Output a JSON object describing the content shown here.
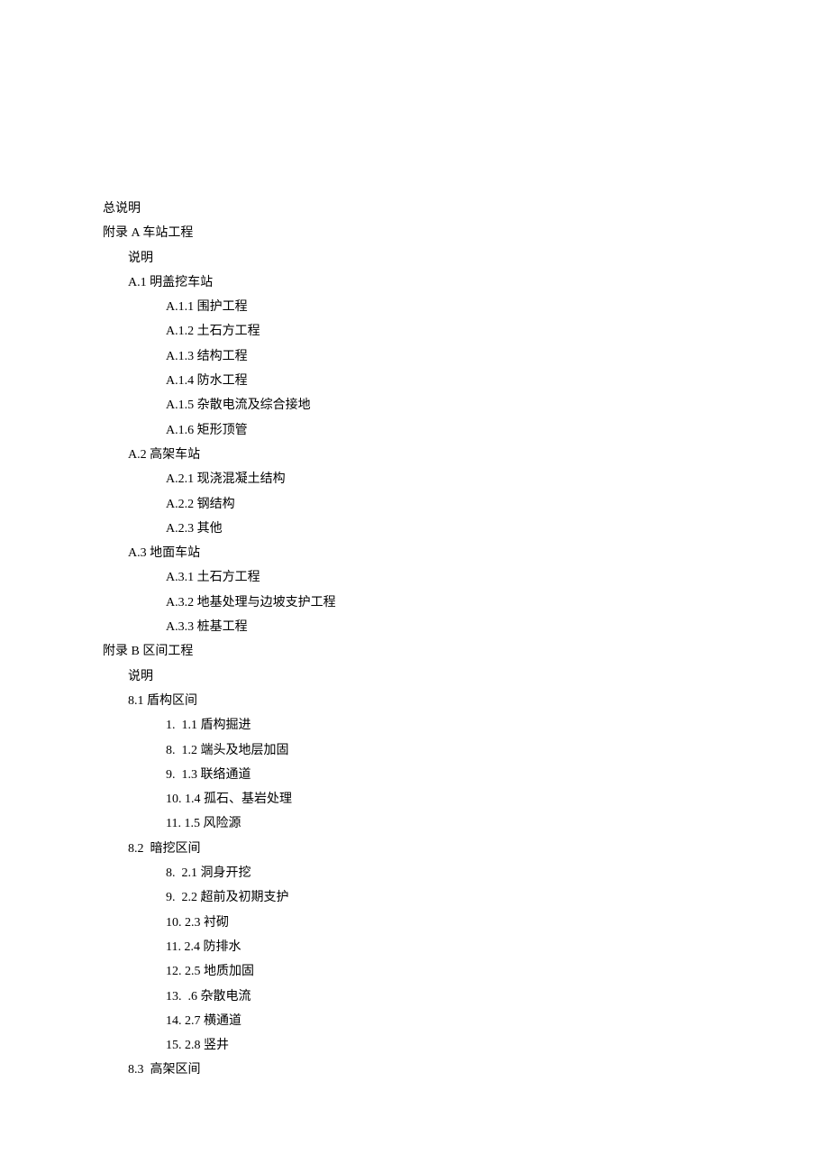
{
  "lines": [
    {
      "level": 0,
      "text": "总说明"
    },
    {
      "level": 0,
      "text": "附录 A 车站工程"
    },
    {
      "level": 1,
      "text": "说明"
    },
    {
      "level": 1,
      "text": "A.1 明盖挖车站"
    },
    {
      "level": 2,
      "text": "A.1.1 围护工程"
    },
    {
      "level": 2,
      "text": "A.1.2 土石方工程"
    },
    {
      "level": 2,
      "text": "A.1.3 结构工程"
    },
    {
      "level": 2,
      "text": "A.1.4 防水工程"
    },
    {
      "level": 2,
      "text": "A.1.5 杂散电流及综合接地"
    },
    {
      "level": 2,
      "text": "A.1.6 矩形顶管"
    },
    {
      "level": 1,
      "text": "A.2 高架车站"
    },
    {
      "level": 2,
      "text": "A.2.1 现浇混凝土结构"
    },
    {
      "level": 2,
      "text": "A.2.2 钢结构"
    },
    {
      "level": 2,
      "text": "A.2.3 其他"
    },
    {
      "level": 1,
      "text": "A.3 地面车站"
    },
    {
      "level": 2,
      "text": "A.3.1 土石方工程"
    },
    {
      "level": 2,
      "text": "A.3.2 地基处理与边坡支护工程"
    },
    {
      "level": 2,
      "text": "A.3.3 桩基工程"
    },
    {
      "level": 0,
      "text": "附录 B 区间工程"
    },
    {
      "level": 1,
      "text": "说明"
    },
    {
      "level": 1,
      "text": "8.1 盾构区间"
    },
    {
      "level": 3,
      "text": "1.  1.1 盾构掘进"
    },
    {
      "level": 3,
      "text": "8.  1.2 端头及地层加固"
    },
    {
      "level": 3,
      "text": "9.  1.3 联络通道"
    },
    {
      "level": 3,
      "text": "10. 1.4 孤石、基岩处理"
    },
    {
      "level": 3,
      "text": "11. 1.5 风险源"
    },
    {
      "level": 1,
      "text": "8.2  暗挖区间"
    },
    {
      "level": 3,
      "text": "8.  2.1 洞身开挖"
    },
    {
      "level": 3,
      "text": "9.  2.2 超前及初期支护"
    },
    {
      "level": 3,
      "text": "10. 2.3 衬砌"
    },
    {
      "level": 3,
      "text": "11. 2.4 防排水"
    },
    {
      "level": 3,
      "text": "12. 2.5 地质加固"
    },
    {
      "level": 3,
      "text": "13.  .6 杂散电流"
    },
    {
      "level": 3,
      "text": "14. 2.7 横通道"
    },
    {
      "level": 3,
      "text": "15. 2.8 竖井"
    },
    {
      "level": 1,
      "text": "8.3  高架区间"
    }
  ]
}
